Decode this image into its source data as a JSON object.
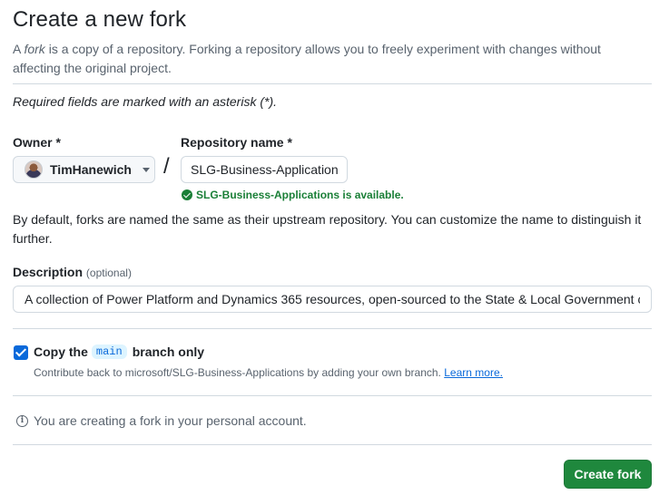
{
  "header": {
    "title": "Create a new fork",
    "subtitle_prefix": "A ",
    "subtitle_em": "fork",
    "subtitle_rest": " is a copy of a repository. Forking a repository allows you to freely experiment with changes without affecting the original project."
  },
  "required_note": "Required fields are marked with an asterisk (*).",
  "owner": {
    "label": "Owner *",
    "value": "TimHanewich"
  },
  "separator": "/",
  "repository": {
    "label": "Repository name *",
    "value": "SLG-Business-Applications",
    "availability": "SLG-Business-Applications is available."
  },
  "naming_info": "By default, forks are named the same as their upstream repository. You can customize the name to distinguish it further.",
  "description": {
    "label": "Description",
    "optional": "(optional)",
    "value": "A collection of Power Platform and Dynamics 365 resources, open-sourced to the State & Local Government community."
  },
  "copy_branch": {
    "checked": true,
    "label_before": "Copy the",
    "branch": "main",
    "label_after": "branch only",
    "help": "Contribute back to microsoft/SLG-Business-Applications by adding your own branch.",
    "learn_more": "Learn more."
  },
  "account_note": "You are creating a fork in your personal account.",
  "submit_label": "Create fork",
  "colors": {
    "primary_button": "#1f883d",
    "success": "#1a7f37",
    "link": "#0969da"
  }
}
